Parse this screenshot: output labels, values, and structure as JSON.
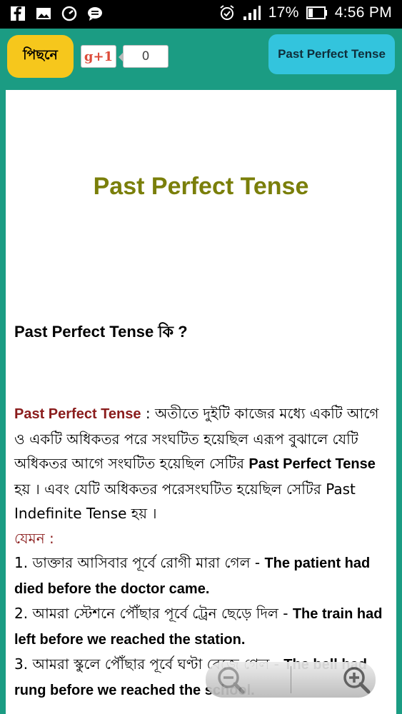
{
  "status_bar": {
    "icons_left": [
      "facebook-icon",
      "image-icon",
      "speedometer-icon",
      "chat-icon"
    ],
    "battery_percent": "17%",
    "time": "4:56 PM"
  },
  "toolbar": {
    "back_label": "পিছনে",
    "gplus_label": "g+1",
    "gplus_count": "0",
    "title_button": "Past Perfect Tense"
  },
  "content": {
    "heading": "Past Perfect Tense",
    "question": "Past Perfect Tense কি ?",
    "definition": {
      "term": "Past Perfect Tense",
      "text_1": " : অতীতে দুইটি কাজের মধ্যে একটি আগে ও একটি অধিকতর পরে সংঘটিত হয়েছিল এরূপ বুঝালে যেটি অধিকতর আগে সংঘটিত হয়েছিল সেটির ",
      "term_bold": "Past Perfect Tense",
      "text_2": " হয় । এবং যেটি অধিকতর পরেসংঘটিত হয়েছিল সেটির Past Indefinite Tense হয় ।"
    },
    "example_label": "যেমন :",
    "examples": [
      {
        "bn": " 1. ডাক্তার আসিবার পূর্বে রোগী মারা গেল - ",
        "en": "The patient had died before the doctor came."
      },
      {
        "bn": "2. আমরা স্টেশনে পৌঁছার পূর্বে ট্রেন ছেড়ে দিল - ",
        "en": "The train had left before we reached the station."
      },
      {
        "bn": "3. আমরা স্কুলে পৌঁছার পূর্বে ঘণ্টা বেজে গেল - ",
        "en": "The bell had rung before we reached the school."
      }
    ]
  },
  "zoom": {
    "out_icon": "zoom-out-icon",
    "in_icon": "zoom-in-icon"
  },
  "colors": {
    "background": "#1b9c83",
    "back_button": "#f6c71c",
    "title_button": "#33c4dd",
    "heading": "#7a7f0a",
    "term": "#8a1c1c"
  }
}
